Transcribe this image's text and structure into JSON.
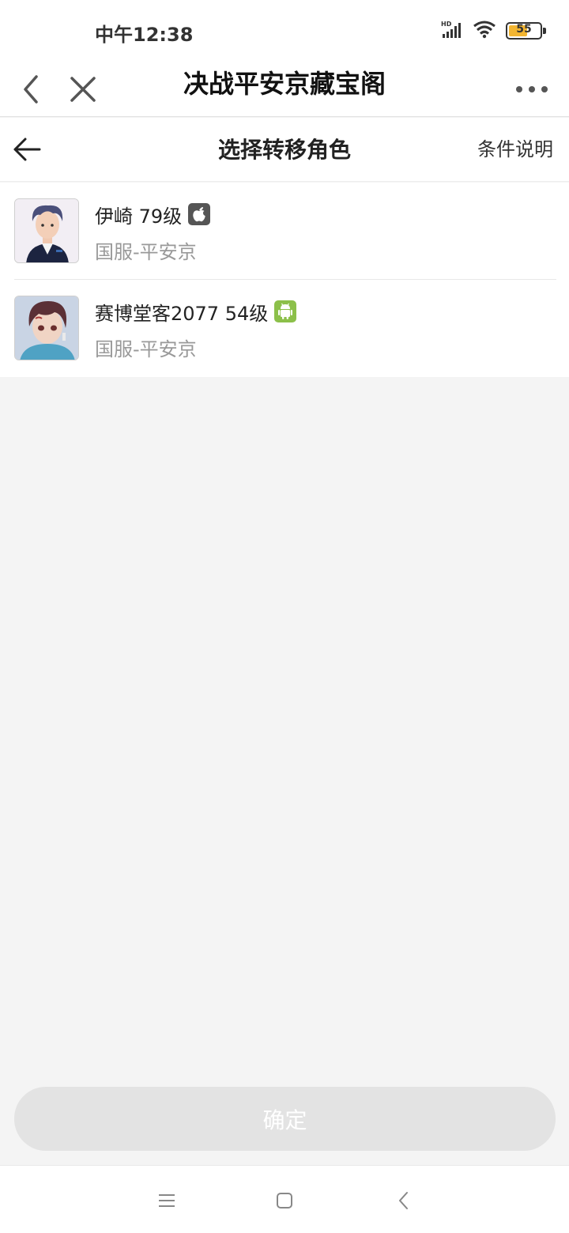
{
  "status": {
    "time": "中午12:38",
    "battery": "55",
    "battery_level": 0.55,
    "icons": [
      "hd-signal-icon",
      "wifi-icon",
      "battery-icon"
    ]
  },
  "titlebar": {
    "title": "决战平安京藏宝阁",
    "icons": [
      "back-chevron-icon",
      "close-icon",
      "more-icon"
    ]
  },
  "header": {
    "title": "选择转移角色",
    "link": "条件说明",
    "icons": [
      "arrow-left-icon"
    ]
  },
  "roles": [
    {
      "name": "伊崎 79级",
      "server": "国服-平安京",
      "platform_icon": "apple-icon",
      "platform_color": "#555555"
    },
    {
      "name": "赛博堂客2077 54级",
      "server": "国服-平安京",
      "platform_icon": "android-icon",
      "platform_color": "#8cc04a"
    }
  ],
  "confirm": {
    "label": "确定",
    "enabled": false
  },
  "navbar": {
    "icons": [
      "menu-icon",
      "home-icon",
      "back-icon"
    ]
  }
}
